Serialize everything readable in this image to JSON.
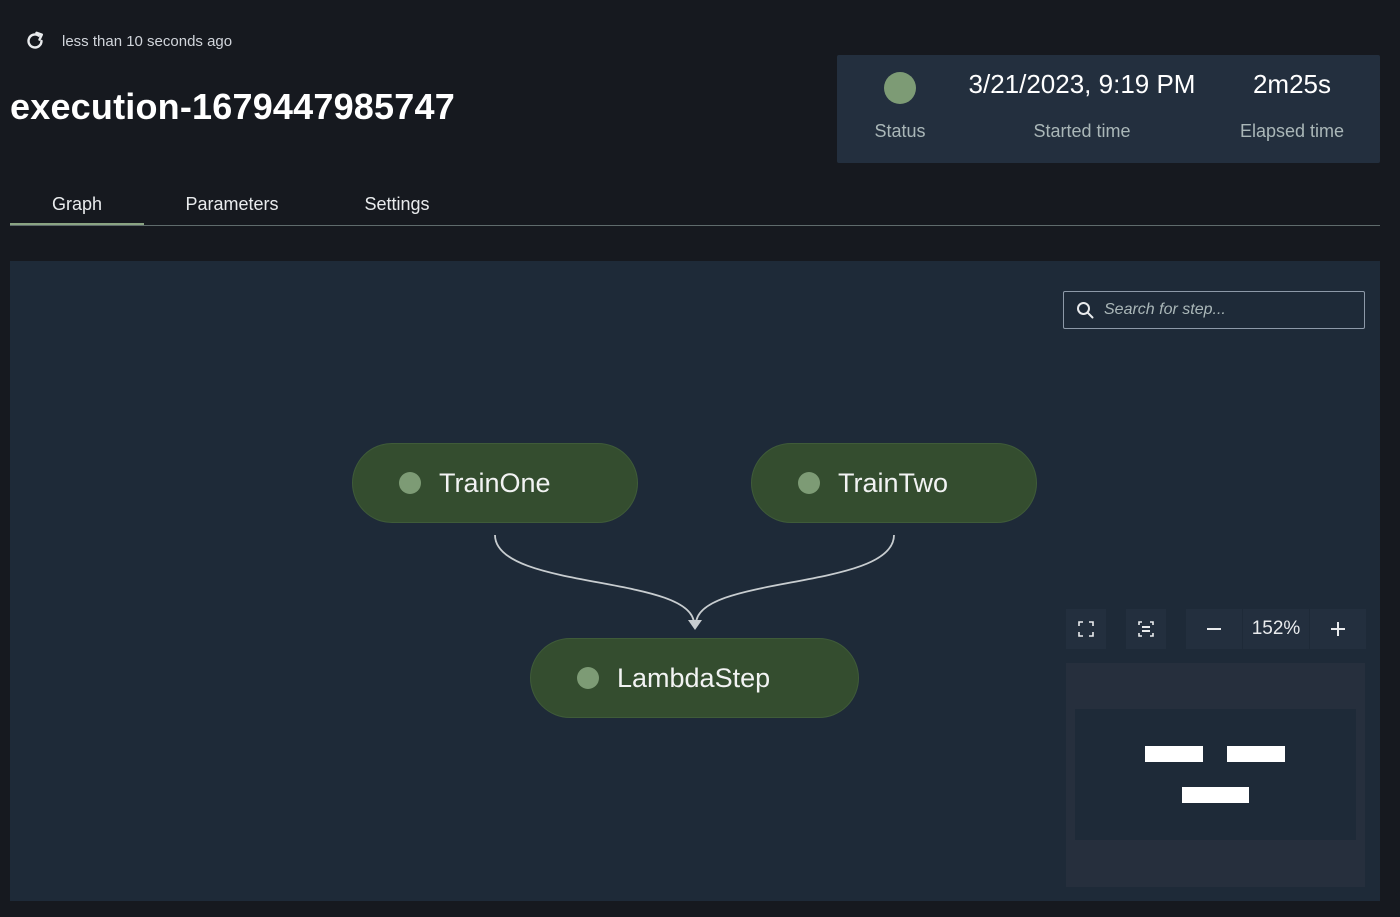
{
  "header": {
    "last_updated": "less than 10 seconds ago",
    "execution_name": "execution-1679447985747"
  },
  "summary": {
    "status_label": "Status",
    "status_color": "#7d9b75",
    "started_time": "3/21/2023, 9:19 PM",
    "started_label": "Started time",
    "elapsed_time": "2m25s",
    "elapsed_label": "Elapsed time"
  },
  "tabs": [
    {
      "label": "Graph",
      "active": true
    },
    {
      "label": "Parameters",
      "active": false
    },
    {
      "label": "Settings",
      "active": false
    }
  ],
  "graph": {
    "search_placeholder": "Search for step...",
    "zoom": "152%",
    "nodes": [
      {
        "label": "TrainOne",
        "status_color": "#7d9b75"
      },
      {
        "label": "TrainTwo",
        "status_color": "#7d9b75"
      },
      {
        "label": "LambdaStep",
        "status_color": "#7d9b75"
      }
    ],
    "edges": [
      {
        "from": "TrainOne",
        "to": "LambdaStep"
      },
      {
        "from": "TrainTwo",
        "to": "LambdaStep"
      }
    ]
  },
  "colors": {
    "background": "#16191f",
    "card": "#232f3e",
    "canvas": "#1e2a38",
    "node_fill": "#344d2f",
    "accent": "#8aa382"
  },
  "icons": {
    "refresh": "refresh-icon",
    "search": "search-icon",
    "fit": "fit-to-screen-icon",
    "center": "center-view-icon",
    "zoom_out": "minus-icon",
    "zoom_in": "plus-icon"
  }
}
